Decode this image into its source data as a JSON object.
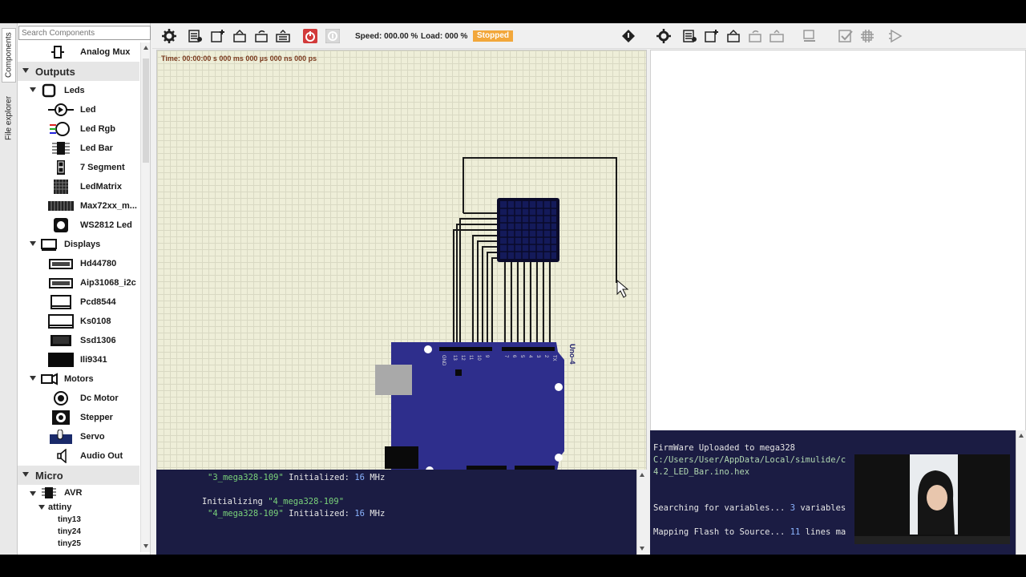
{
  "sidebar_tabs": {
    "components": "Components",
    "files": "File explorer"
  },
  "search": {
    "placeholder": "Search Components"
  },
  "tree": {
    "analog_mux": "Analog Mux",
    "outputs": "Outputs",
    "leds": "Leds",
    "led": "Led",
    "led_rgb": "Led Rgb",
    "led_bar": "Led Bar",
    "seven_segment": "7 Segment",
    "ledmatrix": "LedMatrix",
    "max72xx": "Max72xx_m...",
    "ws2812": "WS2812 Led",
    "displays": "Displays",
    "hd44780": "Hd44780",
    "aip31068": "Aip31068_i2c",
    "pcd8544": "Pcd8544",
    "ks0108": "Ks0108",
    "ssd1306": "Ssd1306",
    "ili9341": "Ili9341",
    "motors": "Motors",
    "dc_motor": "Dc Motor",
    "stepper": "Stepper",
    "servo": "Servo",
    "audio_out": "Audio Out",
    "micro": "Micro",
    "avr": "AVR",
    "attiny": "attiny",
    "tiny13": "tiny13",
    "tiny24": "tiny24",
    "tiny25": "tiny25"
  },
  "toolbar": {
    "speed": "Speed: 000.00 %",
    "load": "Load: 000 %",
    "state": "Stopped"
  },
  "canvas": {
    "time": "Time: 00:00:00 s  000 ms  000 µs  000 ns  000 ps",
    "board_label": "Uno-4"
  },
  "console_left": {
    "line1_name": "\"3_mega328-109\"",
    "line1_rest": " Initialized: ",
    "line1_freq": "16",
    "line1_unit": " MHz",
    "line2_prefix": "Initializing ",
    "line2_name": "\"4_mega328-109\"",
    "line3_name": "\"4_mega328-109\"",
    "line3_rest": " Initialized: ",
    "line3_freq": "16",
    "line3_unit": " MHz"
  },
  "console_right": {
    "line1": "FirmWare Uploaded to mega328",
    "line2": "C:/Users/User/AppData/Local/simulide/c",
    "line3": "4.2_LED_Bar.ino.hex",
    "line4_prefix": "Searching for variables... ",
    "line4_count": "3",
    "line4_suffix": " variables",
    "line5_prefix": "Mapping Flash to Source... ",
    "line5_count": "11",
    "line5_suffix": " lines ma"
  },
  "colors": {
    "accent_stopped": "#f2a73b",
    "console_bg": "#1b1c43",
    "board": "#3a3a9a",
    "canvas": "#eeeed8"
  }
}
